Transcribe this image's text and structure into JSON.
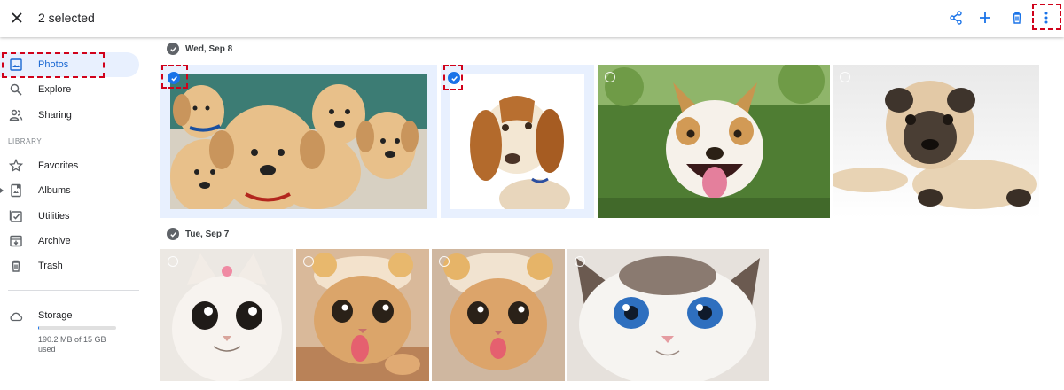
{
  "header": {
    "selection_title": "2 selected",
    "actions": [
      "share-icon",
      "add-icon",
      "trash-icon",
      "more-vert-icon"
    ]
  },
  "sidebar": {
    "items": [
      {
        "label": "Photos",
        "icon": "photo-icon",
        "active": true
      },
      {
        "label": "Explore",
        "icon": "search-icon"
      },
      {
        "label": "Sharing",
        "icon": "people-icon"
      }
    ],
    "library_label": "LIBRARY",
    "library_items": [
      {
        "label": "Favorites",
        "icon": "star-icon"
      },
      {
        "label": "Albums",
        "icon": "album-icon"
      },
      {
        "label": "Utilities",
        "icon": "utilities-icon"
      },
      {
        "label": "Archive",
        "icon": "archive-icon"
      },
      {
        "label": "Trash",
        "icon": "trash-icon"
      }
    ],
    "storage": {
      "label": "Storage",
      "usage_text": "190.2 MB of 15 GB used",
      "used_fraction": 0.013
    }
  },
  "groups": [
    {
      "date": "Wed, Sep 8",
      "photos": [
        {
          "subject": "puppies",
          "selected": true
        },
        {
          "subject": "beagle",
          "selected": true
        },
        {
          "subject": "smiling-dog",
          "selected": false
        },
        {
          "subject": "pug",
          "selected": false
        }
      ]
    },
    {
      "date": "Tue, Sep 7",
      "photos": [
        {
          "subject": "white-cat",
          "selected": false
        },
        {
          "subject": "orange-cat-tongue",
          "selected": false
        },
        {
          "subject": "orange-cat-hat",
          "selected": false
        },
        {
          "subject": "blue-eyed-cat",
          "selected": false
        }
      ]
    }
  ],
  "colors": {
    "accent": "#1a73e8",
    "selected_bg": "#e8f0fe",
    "highlight_box": "#d0021b"
  }
}
